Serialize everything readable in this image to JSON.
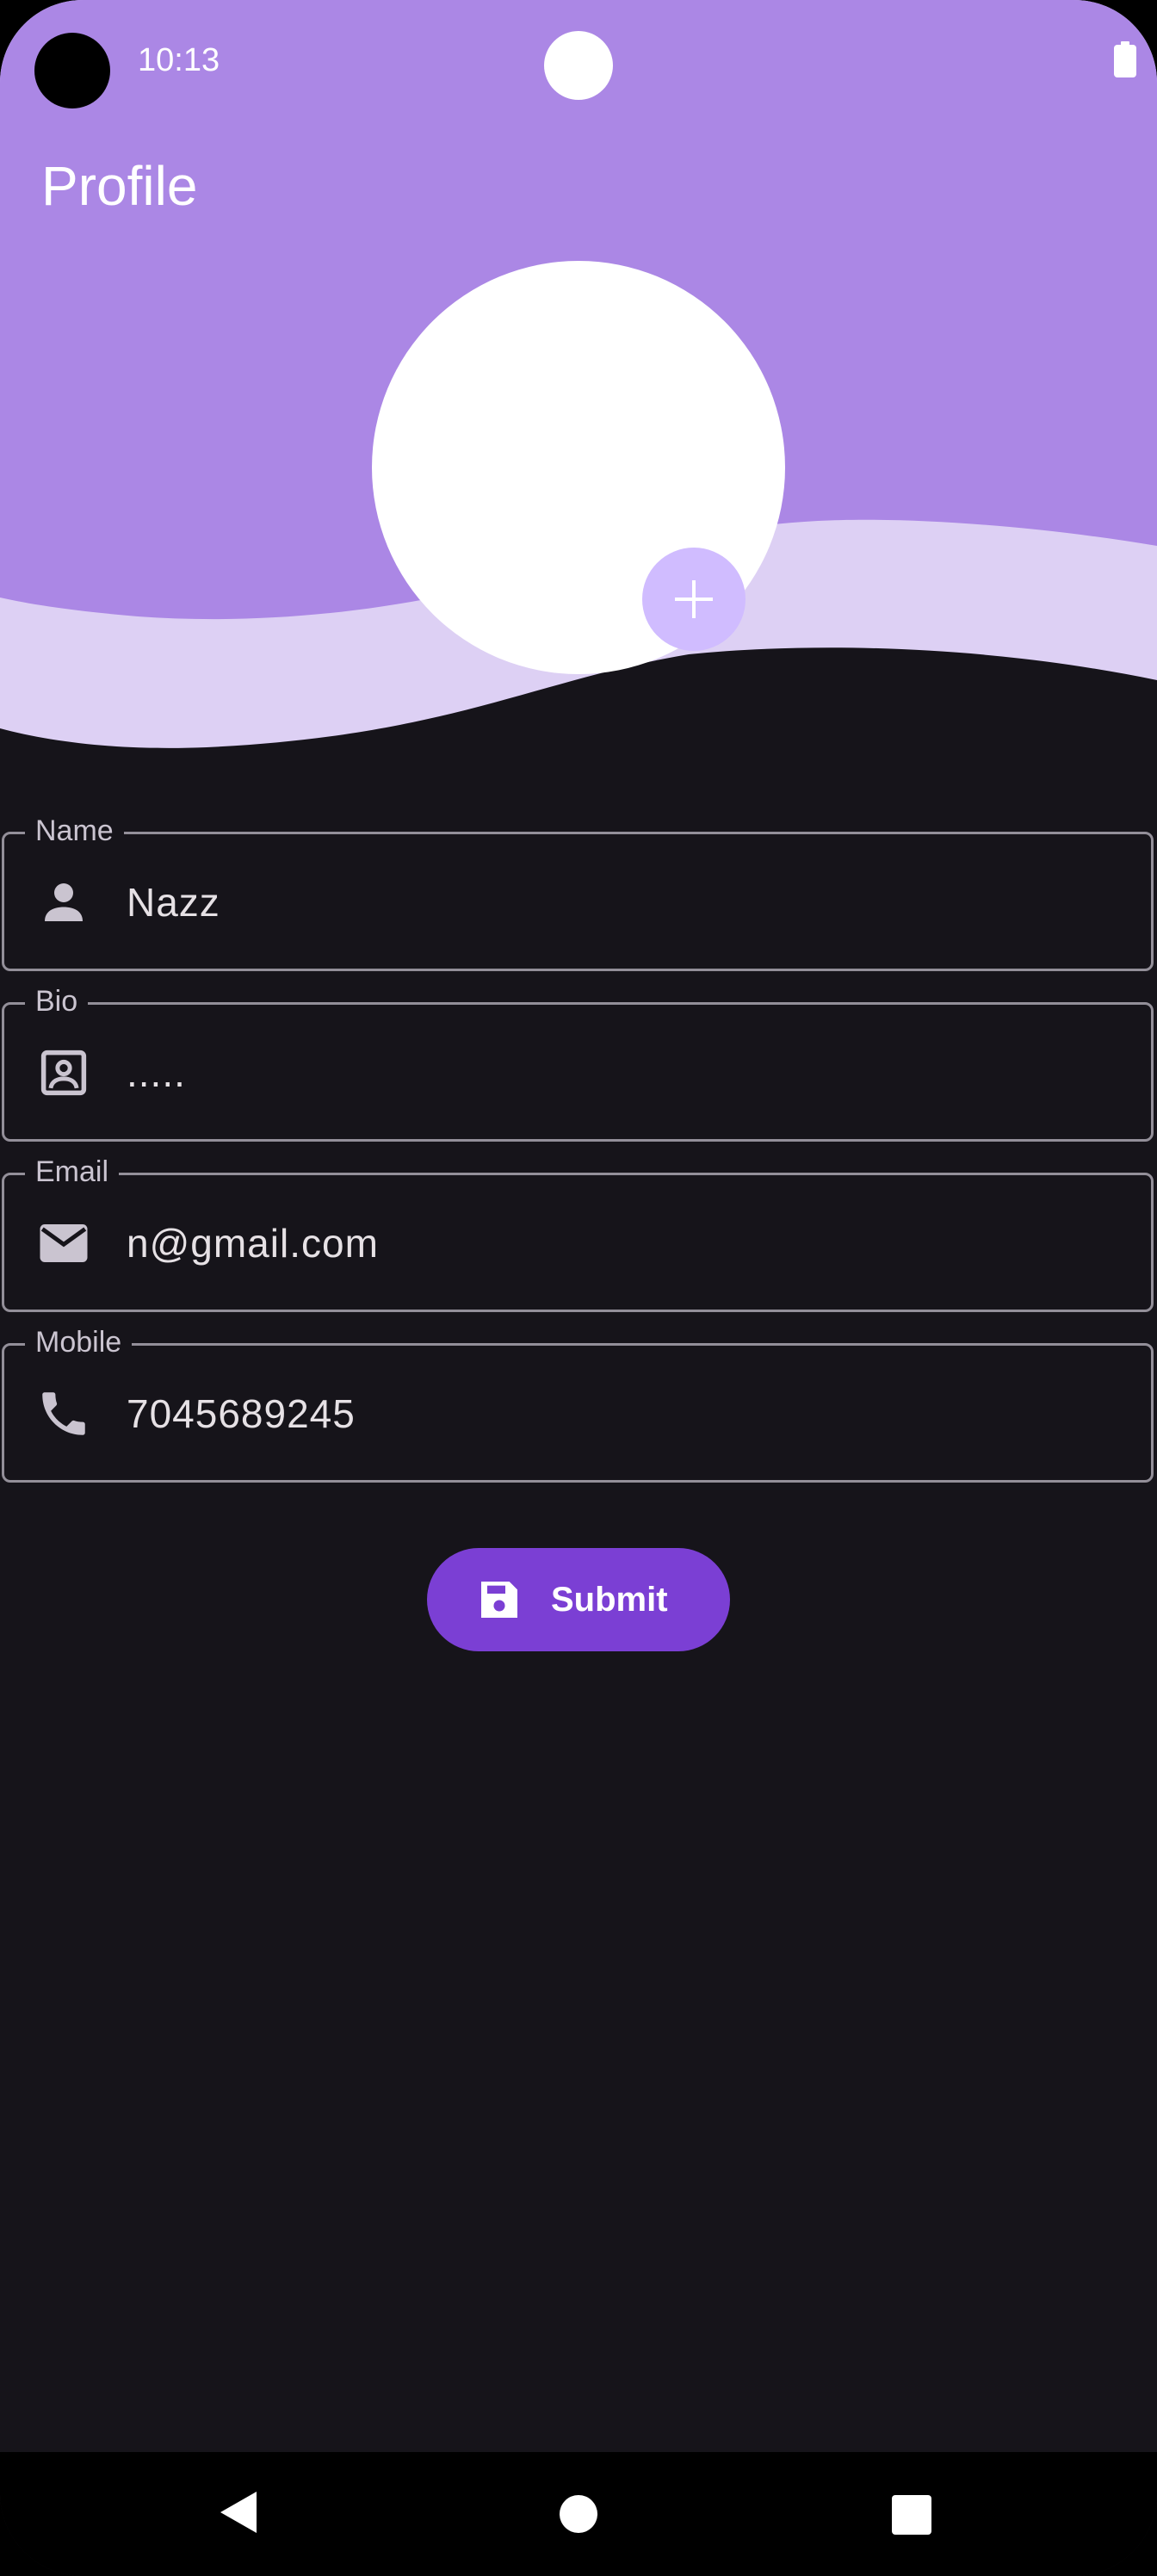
{
  "status_bar": {
    "time": "10:13"
  },
  "header": {
    "title": "Profile"
  },
  "form": {
    "fields": [
      {
        "label": "Name",
        "value": "Nazz",
        "icon": "person-icon"
      },
      {
        "label": "Bio",
        "value": ".....",
        "icon": "contact-card-icon"
      },
      {
        "label": "Email",
        "value": "n@gmail.com",
        "icon": "mail-icon"
      },
      {
        "label": "Mobile",
        "value": "7045689245",
        "icon": "phone-icon"
      }
    ],
    "submit_label": "Submit",
    "submit_icon": "save-icon"
  },
  "colors": {
    "header_primary": "#ab87e5",
    "header_secondary": "#ddd0f4",
    "background": "#16141a",
    "accent_button": "#7b3fd4",
    "fab": "#d0bcff",
    "field_border": "#938f99"
  }
}
